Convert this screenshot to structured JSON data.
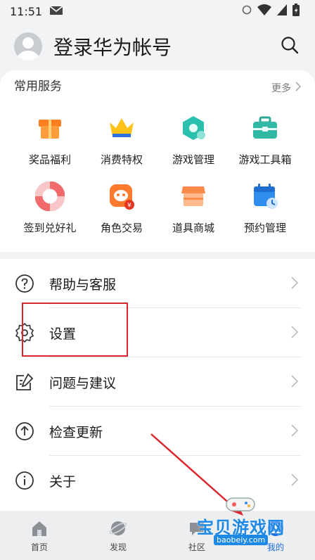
{
  "status": {
    "time": "11:51"
  },
  "header": {
    "title": "登录华为帐号"
  },
  "services": {
    "title": "常用服务",
    "more": "更多",
    "items": [
      {
        "label": "奖品福利",
        "icon": "gift-icon",
        "color": "#ff8a26"
      },
      {
        "label": "消费特权",
        "icon": "crown-icon",
        "color": "#ffc21a"
      },
      {
        "label": "游戏管理",
        "icon": "hexagon-game-icon",
        "color": "#2bbfae"
      },
      {
        "label": "游戏工具箱",
        "icon": "toolbox-icon",
        "color": "#33b8a6"
      },
      {
        "label": "签到兑好礼",
        "icon": "lifebuoy-icon",
        "color": "#f26b6b"
      },
      {
        "label": "角色交易",
        "icon": "character-trade-icon",
        "color": "#ff7a2e"
      },
      {
        "label": "道具商城",
        "icon": "store-icon",
        "color": "#ff8a4a"
      },
      {
        "label": "预约管理",
        "icon": "calendar-clock-icon",
        "color": "#2f8df0"
      }
    ]
  },
  "menu": [
    {
      "label": "帮助与客服",
      "icon": "help-icon"
    },
    {
      "label": "设置",
      "icon": "gear-icon"
    },
    {
      "label": "问题与建议",
      "icon": "feedback-icon"
    },
    {
      "label": "检查更新",
      "icon": "update-icon"
    },
    {
      "label": "关于",
      "icon": "info-icon"
    }
  ],
  "tabs": [
    {
      "label": "首页",
      "icon": "home-icon"
    },
    {
      "label": "发现",
      "icon": "planet-icon"
    },
    {
      "label": "社区",
      "icon": "community-icon"
    },
    {
      "label": "我的",
      "icon": "profile-icon",
      "active": true
    }
  ],
  "watermark": {
    "text": "宝贝游戏网",
    "url": "baobeiy.com"
  },
  "colors": {
    "accent": "#1a6fe6",
    "highlight": "#d9272e",
    "arrow": "#d9272e"
  }
}
